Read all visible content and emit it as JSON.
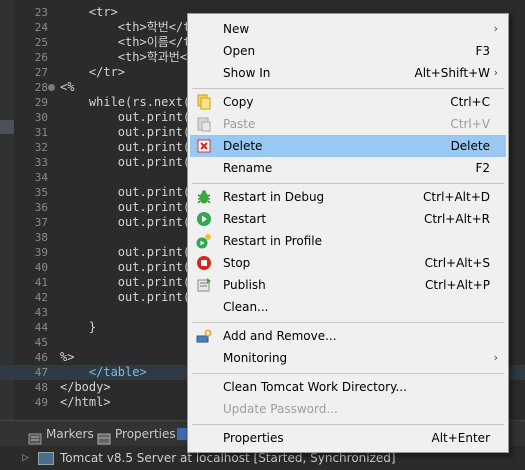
{
  "editor": {
    "lines": [
      {
        "num": "23",
        "code": "    <tr>"
      },
      {
        "num": "24",
        "code": "        <th>학번</th>"
      },
      {
        "num": "25",
        "code": "        <th>이름</th>"
      },
      {
        "num": "26",
        "code": "        <th>학과번</th>"
      },
      {
        "num": "27",
        "code": "    </tr>"
      },
      {
        "num": "28",
        "code": "<%"
      },
      {
        "num": "29",
        "code": "    while(rs.next("
      },
      {
        "num": "30",
        "code": "        out.print("
      },
      {
        "num": "31",
        "code": "        out.print("
      },
      {
        "num": "32",
        "code": "        out.print("
      },
      {
        "num": "33",
        "code": "        out.print("
      },
      {
        "num": "34",
        "code": ""
      },
      {
        "num": "35",
        "code": "        out.print("
      },
      {
        "num": "36",
        "code": "        out.print("
      },
      {
        "num": "37",
        "code": "        out.print("
      },
      {
        "num": "38",
        "code": ""
      },
      {
        "num": "39",
        "code": "        out.print("
      },
      {
        "num": "40",
        "code": "        out.print("
      },
      {
        "num": "41",
        "code": "        out.print("
      },
      {
        "num": "42",
        "code": "        out.print("
      },
      {
        "num": "43",
        "code": ""
      },
      {
        "num": "44",
        "code": "    }"
      },
      {
        "num": "45",
        "code": ""
      },
      {
        "num": "46",
        "code": "%>"
      },
      {
        "num": "47",
        "code": "    </table>"
      },
      {
        "num": "48",
        "code": "</body>"
      },
      {
        "num": "49",
        "code": "</html>"
      }
    ]
  },
  "bottom_tabs": {
    "markers": "Markers",
    "properties": "Properties"
  },
  "server": {
    "label": "Tomcat v8.5 Server at localhost  [Started, Synchronized]"
  },
  "menu": {
    "new": {
      "label": "New"
    },
    "open": {
      "label": "Open",
      "shortcut": "F3"
    },
    "show_in": {
      "label": "Show In",
      "shortcut": "Alt+Shift+W"
    },
    "copy": {
      "label": "Copy",
      "shortcut": "Ctrl+C"
    },
    "paste": {
      "label": "Paste",
      "shortcut": "Ctrl+V"
    },
    "delete": {
      "label": "Delete",
      "shortcut": "Delete"
    },
    "rename": {
      "label": "Rename",
      "shortcut": "F2"
    },
    "restart_debug": {
      "label": "Restart in Debug",
      "shortcut": "Ctrl+Alt+D"
    },
    "restart": {
      "label": "Restart",
      "shortcut": "Ctrl+Alt+R"
    },
    "restart_profile": {
      "label": "Restart in Profile"
    },
    "stop": {
      "label": "Stop",
      "shortcut": "Ctrl+Alt+S"
    },
    "publish": {
      "label": "Publish",
      "shortcut": "Ctrl+Alt+P"
    },
    "clean": {
      "label": "Clean..."
    },
    "add_remove": {
      "label": "Add and Remove..."
    },
    "monitoring": {
      "label": "Monitoring"
    },
    "clean_tomcat": {
      "label": "Clean Tomcat Work Directory..."
    },
    "update_password": {
      "label": "Update Password..."
    },
    "properties": {
      "label": "Properties",
      "shortcut": "Alt+Enter"
    }
  },
  "colors": {
    "highlight": "#99c9f3",
    "menu_bg": "#f0f0f0",
    "editor_bg": "#2b2b2b"
  }
}
